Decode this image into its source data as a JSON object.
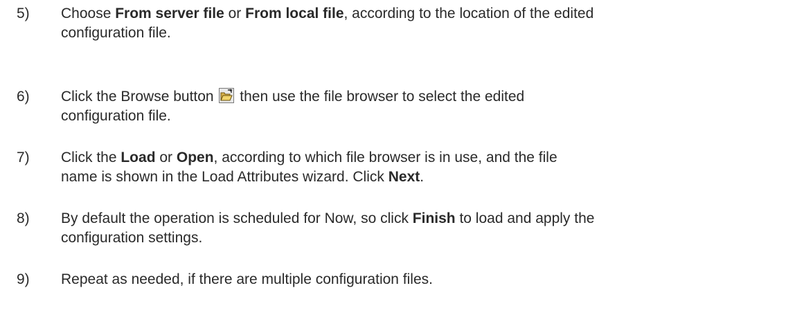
{
  "steps": [
    {
      "number": "5)",
      "parts": [
        "Choose ",
        "From server file",
        " or ",
        "From local file",
        ", according to the location of the edited",
        "configuration file."
      ]
    },
    {
      "number": "6)",
      "parts": [
        "Click the Browse button ",
        " then use the file browser to select the edited",
        "configuration file."
      ],
      "icon": "open-folder-icon"
    },
    {
      "number": "7)",
      "parts": [
        "Click the ",
        "Load",
        " or ",
        "Open",
        ", according to which file browser is in use, and the file",
        "name is shown in the Load Attributes wizard. Click ",
        "Next",
        "."
      ]
    },
    {
      "number": "8)",
      "parts": [
        "By default the operation is scheduled for Now, so click ",
        "Finish",
        " to load and apply the",
        "configuration settings."
      ]
    },
    {
      "number": "9)",
      "parts": [
        "Repeat as needed, if there are multiple configuration files."
      ]
    }
  ]
}
